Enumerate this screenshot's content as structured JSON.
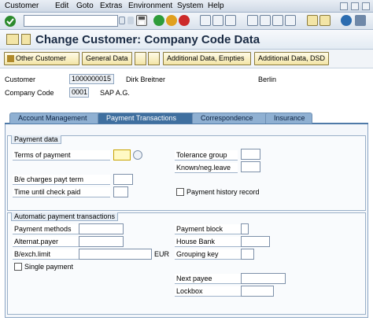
{
  "menu": [
    "Customer",
    "Edit",
    "Goto",
    "Extras",
    "Environment",
    "System",
    "Help"
  ],
  "title": "Change Customer: Company Code Data",
  "app_toolbar": {
    "other_customer": "Other Customer",
    "general_data": "General Data",
    "additional_empties": "Additional Data, Empties",
    "additional_dsd": "Additional Data, DSD"
  },
  "header": {
    "customer_label": "Customer",
    "customer_value": "1000000015",
    "customer_name": "Dirk Breitner",
    "city": "Berlin",
    "company_code_label": "Company Code",
    "company_code_value": "0001",
    "company_name": "SAP A.G."
  },
  "tabs": [
    "Account Management",
    "Payment Transactions",
    "Correspondence",
    "Insurance"
  ],
  "payment_data": {
    "title": "Payment data",
    "terms_of_payment": "Terms of payment",
    "be_charges": "B/e charges payt term",
    "time_until_check_paid": "Time until check paid",
    "tolerance_group": "Tolerance group",
    "known_neg_leave": "Known/neg.leave",
    "payment_history_record": "Payment history record"
  },
  "auto_payment": {
    "title": "Automatic payment transactions",
    "payment_methods": "Payment methods",
    "alternat_payer": "Alternat.payer",
    "bexch_limit": "B/exch.limit",
    "currency": "EUR",
    "single_payment": "Single payment",
    "payment_block": "Payment block",
    "house_bank": "House Bank",
    "grouping_key": "Grouping key",
    "next_payee": "Next payee",
    "lockbox": "Lockbox"
  }
}
